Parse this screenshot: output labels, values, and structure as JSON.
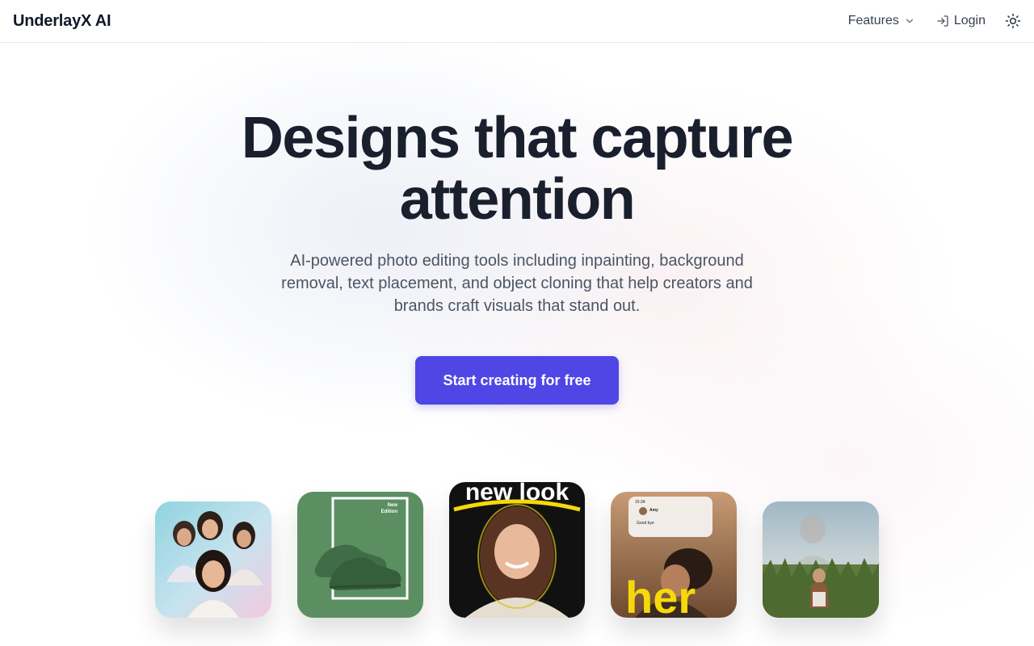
{
  "header": {
    "brand": "UnderlayX AI",
    "nav": {
      "features_label": "Features",
      "login_label": "Login"
    }
  },
  "hero": {
    "title_line1": "Designs that capture",
    "title_line2": "attention",
    "subtitle": "AI-powered photo editing tools including inpainting, background removal, text placement, and object cloning that help creators and brands craft visuals that stand out.",
    "cta_label": "Start creating for free"
  },
  "gallery": {
    "card2_text_line1": "New",
    "card2_text_line2": "Edition",
    "card3_text": "new look",
    "card4_chat_name": "Amy",
    "card4_chat_msg": "Good bye",
    "card4_time": "15:34",
    "card4_big_text": "her"
  },
  "colors": {
    "accent": "#4f46e5",
    "title": "#1a1f2e",
    "subtitle": "#4b5563"
  },
  "icons": {
    "features_chevron": "chevron-down-icon",
    "login": "login-icon",
    "theme": "sun-icon"
  }
}
